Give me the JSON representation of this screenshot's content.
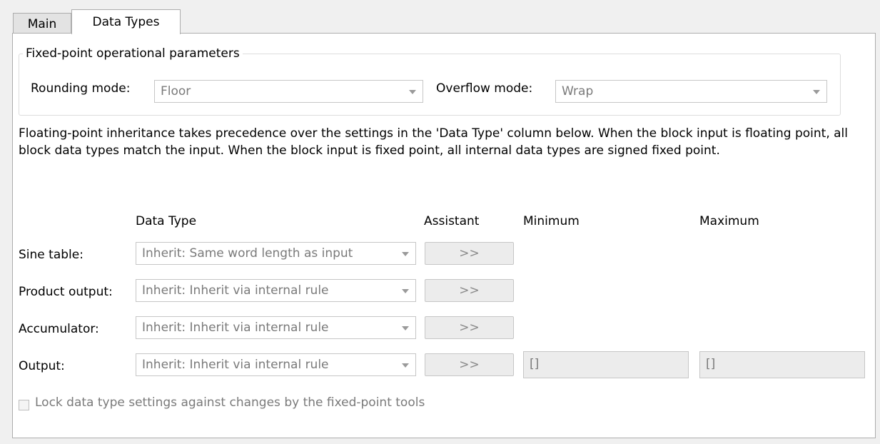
{
  "tabs": [
    {
      "label": "Main",
      "active": false
    },
    {
      "label": "Data Types",
      "active": true
    }
  ],
  "fixed_point_group": {
    "legend": "Fixed-point operational parameters",
    "rounding_label": "Rounding mode:",
    "rounding_value": "Floor",
    "overflow_label": "Overflow mode:",
    "overflow_value": "Wrap"
  },
  "description": "Floating-point inheritance takes precedence over the settings in the 'Data Type' column below. When the block input is floating point, all block data types match the input. When the block input is fixed point, all internal data types are signed fixed point.",
  "table": {
    "headers": {
      "data_type": "Data Type",
      "assistant": "Assistant",
      "minimum": "Minimum",
      "maximum": "Maximum"
    },
    "rows": [
      {
        "label": "Sine table:",
        "data_type": "Inherit: Same word length as input",
        "assistant": ">>"
      },
      {
        "label": "Product output:",
        "data_type": "Inherit: Inherit via internal rule",
        "assistant": ">>"
      },
      {
        "label": "Accumulator:",
        "data_type": "Inherit: Inherit via internal rule",
        "assistant": ">>"
      },
      {
        "label": "Output:",
        "data_type": "Inherit: Inherit via internal rule",
        "assistant": ">>",
        "minimum": "[]",
        "maximum": "[]"
      }
    ]
  },
  "lock_checkbox": {
    "label": "Lock data type settings against changes by the fixed-point tools",
    "checked": false
  },
  "colors": {
    "panel_bg": "#ffffff",
    "window_bg": "#f0f0f0",
    "disabled_text": "#7a7a7a",
    "border": "#adadad"
  }
}
